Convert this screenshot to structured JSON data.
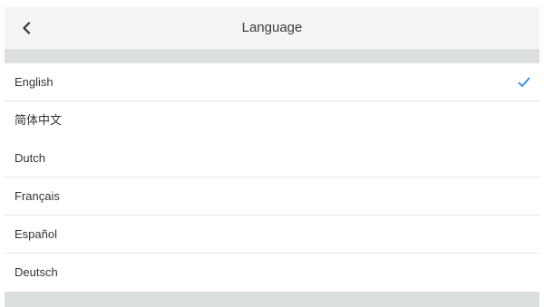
{
  "header": {
    "title": "Language",
    "back_icon": "chevron-left-icon"
  },
  "languages": [
    {
      "label": "English",
      "selected": true
    },
    {
      "label": "简体中文",
      "selected": false
    },
    {
      "label": "Dutch",
      "selected": false
    },
    {
      "label": "Français",
      "selected": false
    },
    {
      "label": "Español",
      "selected": false
    },
    {
      "label": "Deutsch",
      "selected": false
    }
  ],
  "colors": {
    "accent": "#2d8be6",
    "header_bg": "#f4f4f4",
    "band_bg": "#dcdfe0",
    "text": "#333333"
  }
}
